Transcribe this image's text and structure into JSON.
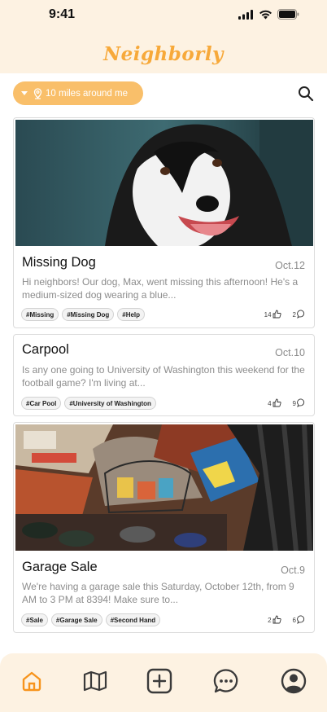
{
  "status_bar": {
    "time": "9:41"
  },
  "app": {
    "title": "Neighborly",
    "accent": "#f7a93a",
    "header_bg": "#fdf2e2"
  },
  "filter": {
    "label": "10 miles around me",
    "icon": "location-pin-icon",
    "caret_icon": "caret-down-icon"
  },
  "search": {
    "icon": "search-icon"
  },
  "posts": [
    {
      "title": "Missing Dog",
      "date": "Oct.12",
      "description": "Hi neighbors! Our dog, Max, went missing this afternoon! He's a medium-sized dog wearing a blue...",
      "tags": [
        "#Missing",
        "#Missing Dog",
        "#Help"
      ],
      "likes": "14",
      "comments": "2",
      "photo": "border-collie-photo"
    },
    {
      "title": "Carpool",
      "date": "Oct.10",
      "description": "Is any one going to University of Washington this weekend for the football game? I'm living at...",
      "tags": [
        "#Car Pool",
        "#University of Washington"
      ],
      "likes": "4",
      "comments": "9"
    },
    {
      "title": "Garage Sale",
      "date": "Oct.9",
      "description": "We're having a garage sale this Saturday, October 12th, from 9 AM to 3 PM at 8394! Make sure to...",
      "tags": [
        "#Sale",
        "#Garage Sale",
        "#Second Hand"
      ],
      "likes": "2",
      "comments": "6",
      "photo": "garage-sale-photo"
    }
  ],
  "bottom_nav": {
    "items": [
      "home-icon",
      "map-icon",
      "add-post-icon",
      "chat-icon",
      "profile-icon"
    ],
    "active": "home-icon",
    "active_color": "#f7941d",
    "inactive_color": "#3a3a3a"
  }
}
